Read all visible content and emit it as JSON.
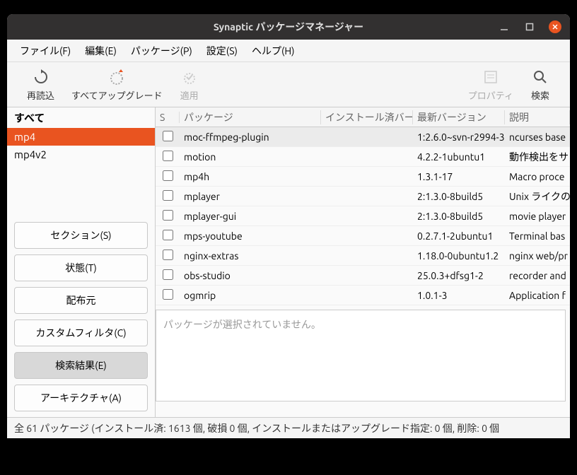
{
  "window": {
    "title": "Synaptic パッケージマネージャー"
  },
  "menu": {
    "file": "ファイル(F)",
    "edit": "編集(E)",
    "package": "パッケージ(P)",
    "settings": "設定(S)",
    "help": "ヘルプ(H)"
  },
  "toolbar": {
    "reload": "再読込",
    "upgrade_all": "すべてアップグレード",
    "apply": "適用",
    "properties": "プロパティ",
    "search": "検索"
  },
  "tree": {
    "all": "すべて",
    "mp4": "mp4",
    "mp4v2": "mp4v2"
  },
  "side_buttons": {
    "sections": "セクション(S)",
    "status": "状態(T)",
    "origin": "配布元",
    "custom": "カスタムフィルタ(C)",
    "search_results": "検索結果(E)",
    "architecture": "アーキテクチャ(A)"
  },
  "columns": {
    "s": "S",
    "package": "パッケージ",
    "installed": "インストール済バー",
    "latest": "最新バージョン",
    "description": "説明"
  },
  "packages": [
    {
      "name": "moc-ffmpeg-plugin",
      "installed": "",
      "latest": "1:2.6.0~svn-r2994-3",
      "desc": "ncurses base"
    },
    {
      "name": "motion",
      "installed": "",
      "latest": "4.2.2-1ubuntu1",
      "desc": "動作検出をサ"
    },
    {
      "name": "mp4h",
      "installed": "",
      "latest": "1.3.1-17",
      "desc": "Macro proce"
    },
    {
      "name": "mplayer",
      "installed": "",
      "latest": "2:1.3.0-8build5",
      "desc": "Unix ライクの"
    },
    {
      "name": "mplayer-gui",
      "installed": "",
      "latest": "2:1.3.0-8build5",
      "desc": "movie player"
    },
    {
      "name": "mps-youtube",
      "installed": "",
      "latest": "0.2.7.1-2ubuntu1",
      "desc": "Terminal bas"
    },
    {
      "name": "nginx-extras",
      "installed": "",
      "latest": "1.18.0-0ubuntu1.2",
      "desc": "nginx web/pr"
    },
    {
      "name": "obs-studio",
      "installed": "",
      "latest": "25.0.3+dfsg1-2",
      "desc": "recorder and"
    },
    {
      "name": "ogmrip",
      "installed": "",
      "latest": "1.0.1-3",
      "desc": "Application f"
    }
  ],
  "detail": {
    "empty": "パッケージが選択されていません。"
  },
  "status": {
    "text": "全 61 パッケージ (インストール済: 1613 個, 破損 0 個, インストールまたはアップグレード指定: 0 個, 削除: 0 個"
  }
}
